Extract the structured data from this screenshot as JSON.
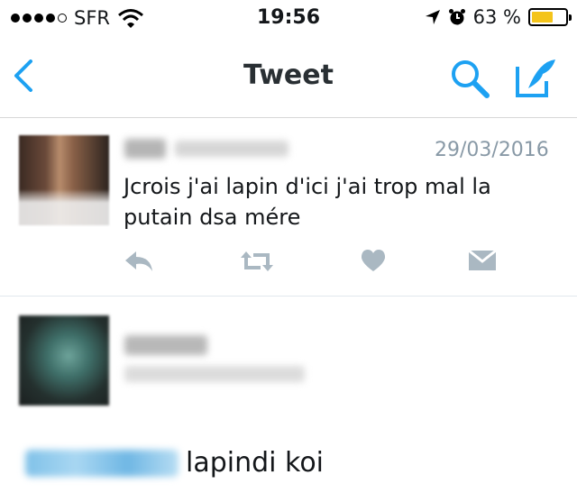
{
  "status_bar": {
    "carrier": "SFR",
    "time": "19:56",
    "battery_percent": "63 %",
    "battery_level": 0.63,
    "signal_bars": 4,
    "signal_total": 5,
    "icons": [
      "wifi-icon",
      "location-icon",
      "alarm-icon",
      "battery-icon"
    ]
  },
  "nav": {
    "title": "Tweet",
    "accent": "#1da1f2",
    "icons": [
      "back-chevron-icon",
      "search-icon",
      "compose-icon"
    ]
  },
  "tweet": {
    "date": "29/03/2016",
    "text": "Jcrois j'ai lapin d'ici j'ai trop mal la putain dsa mére",
    "action_icons": [
      "reply-icon",
      "retweet-icon",
      "like-icon",
      "direct-message-icon"
    ],
    "action_color": "#aab8c2"
  },
  "reply": {
    "text": "lapindi koi"
  }
}
